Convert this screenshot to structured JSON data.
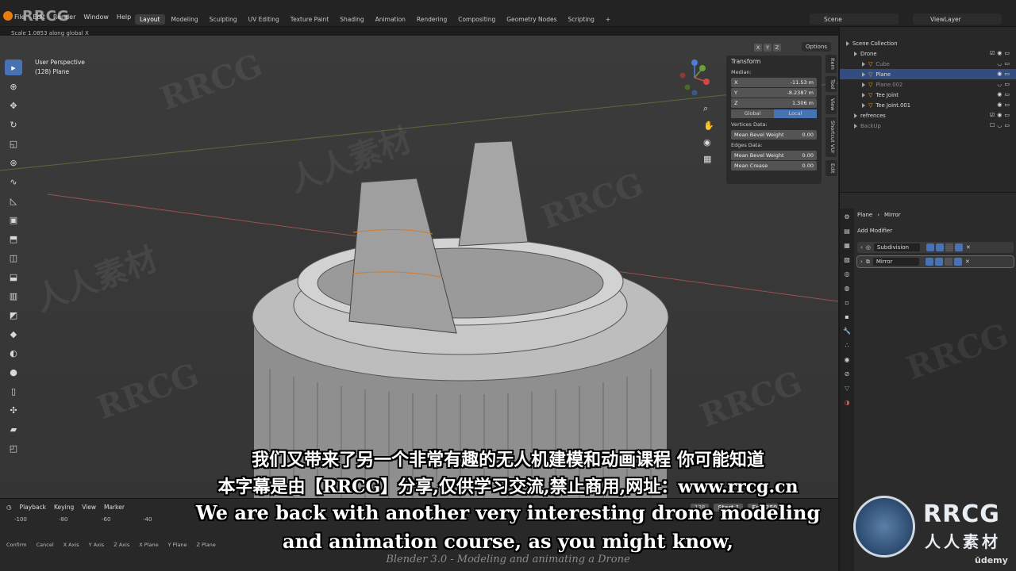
{
  "topbar": {
    "watermark_logo": "RRCG",
    "menu": [
      "File",
      "Edit",
      "Render",
      "Window",
      "Help"
    ],
    "tabs": [
      "Layout",
      "Modeling",
      "Sculpting",
      "UV Editing",
      "Texture Paint",
      "Shading",
      "Animation",
      "Rendering",
      "Compositing",
      "Geometry Nodes",
      "Scripting",
      "+"
    ],
    "active_tab": "Layout",
    "scene": "Scene",
    "view_layer": "ViewLayer",
    "status_message": "Scale 1.0853 along global X"
  },
  "viewport": {
    "view_name": "User Perspective",
    "object_info": "(128) Plane",
    "axis_buttons": [
      "X",
      "Y",
      "Z"
    ],
    "options_label": "Options",
    "gizmo": {
      "x": "X",
      "y": "Y",
      "z": "Z"
    }
  },
  "npanel": {
    "title": "Transform",
    "median_label": "Median:",
    "fields": [
      {
        "label": "X",
        "value": "-11.53 m"
      },
      {
        "label": "Y",
        "value": "-8.2387 m"
      },
      {
        "label": "Z",
        "value": "1.306 m"
      }
    ],
    "toggle": [
      "Global",
      "Local"
    ],
    "active_toggle": "Local",
    "vertices_label": "Vertices Data:",
    "vertices_field": {
      "label": "Mean Bevel Weight",
      "value": "0.00"
    },
    "edges_label": "Edges Data:",
    "edges_fields": [
      {
        "label": "Mean Bevel Weight",
        "value": "0.00"
      },
      {
        "label": "Mean Crease",
        "value": "0.00"
      }
    ],
    "side_tabs": [
      "Item",
      "Tool",
      "View",
      "Shortcut VUr",
      "Edit"
    ]
  },
  "outliner": {
    "rows": [
      {
        "label": "Scene Collection",
        "indent": 0,
        "state": "normal"
      },
      {
        "label": "Drone",
        "indent": 1,
        "state": "normal"
      },
      {
        "label": "Cube",
        "indent": 2,
        "state": "dim"
      },
      {
        "label": "Plane",
        "indent": 2,
        "state": "selected"
      },
      {
        "label": "Plane.002",
        "indent": 2,
        "state": "dim"
      },
      {
        "label": "Tee Joint",
        "indent": 2,
        "state": "normal"
      },
      {
        "label": "Tee Joint.001",
        "indent": 2,
        "state": "normal"
      },
      {
        "label": "refrences",
        "indent": 1,
        "state": "normal"
      },
      {
        "label": "BackUp",
        "indent": 1,
        "state": "dim"
      }
    ]
  },
  "properties": {
    "breadcrumb_object": "Plane",
    "breadcrumb_modifier": "Mirror",
    "add_modifier_label": "Add Modifier",
    "modifiers": [
      {
        "name": "Subdivision",
        "active": false
      },
      {
        "name": "Mirror",
        "active": true
      }
    ]
  },
  "timeline": {
    "menus": [
      "Playback",
      "Keying",
      "View",
      "Marker"
    ],
    "current_frame": "128",
    "start_label": "Start",
    "start_value": "1",
    "end_label": "End",
    "end_value": "250",
    "ruler": [
      "-100",
      "-80",
      "-60",
      "-40"
    ]
  },
  "statusbar": {
    "items": [
      "Confirm",
      "Cancel",
      "X Axis",
      "Y Axis",
      "Z Axis",
      "X Plane",
      "Y Plane",
      "Z Plane"
    ]
  },
  "subtitles": {
    "cn_line1": "我们又带来了另一个非常有趣的无人机建模和动画课程 你可能知道",
    "cn_line2": "本字幕是由【RRCG】分享,仅供学习交流,禁止商用,网址：www.rrcg.cn",
    "en_line1": "We are back with another very interesting drone modeling",
    "en_line2": "and animation course, as you might know,"
  },
  "course_title": "Blender 3.0 - Modeling and animating a Drone",
  "brand": {
    "rrcg": "RRCG",
    "cn": "人人素材",
    "udemy": "ūdemy"
  },
  "watermarks": [
    "RRCG",
    "人人素材"
  ]
}
